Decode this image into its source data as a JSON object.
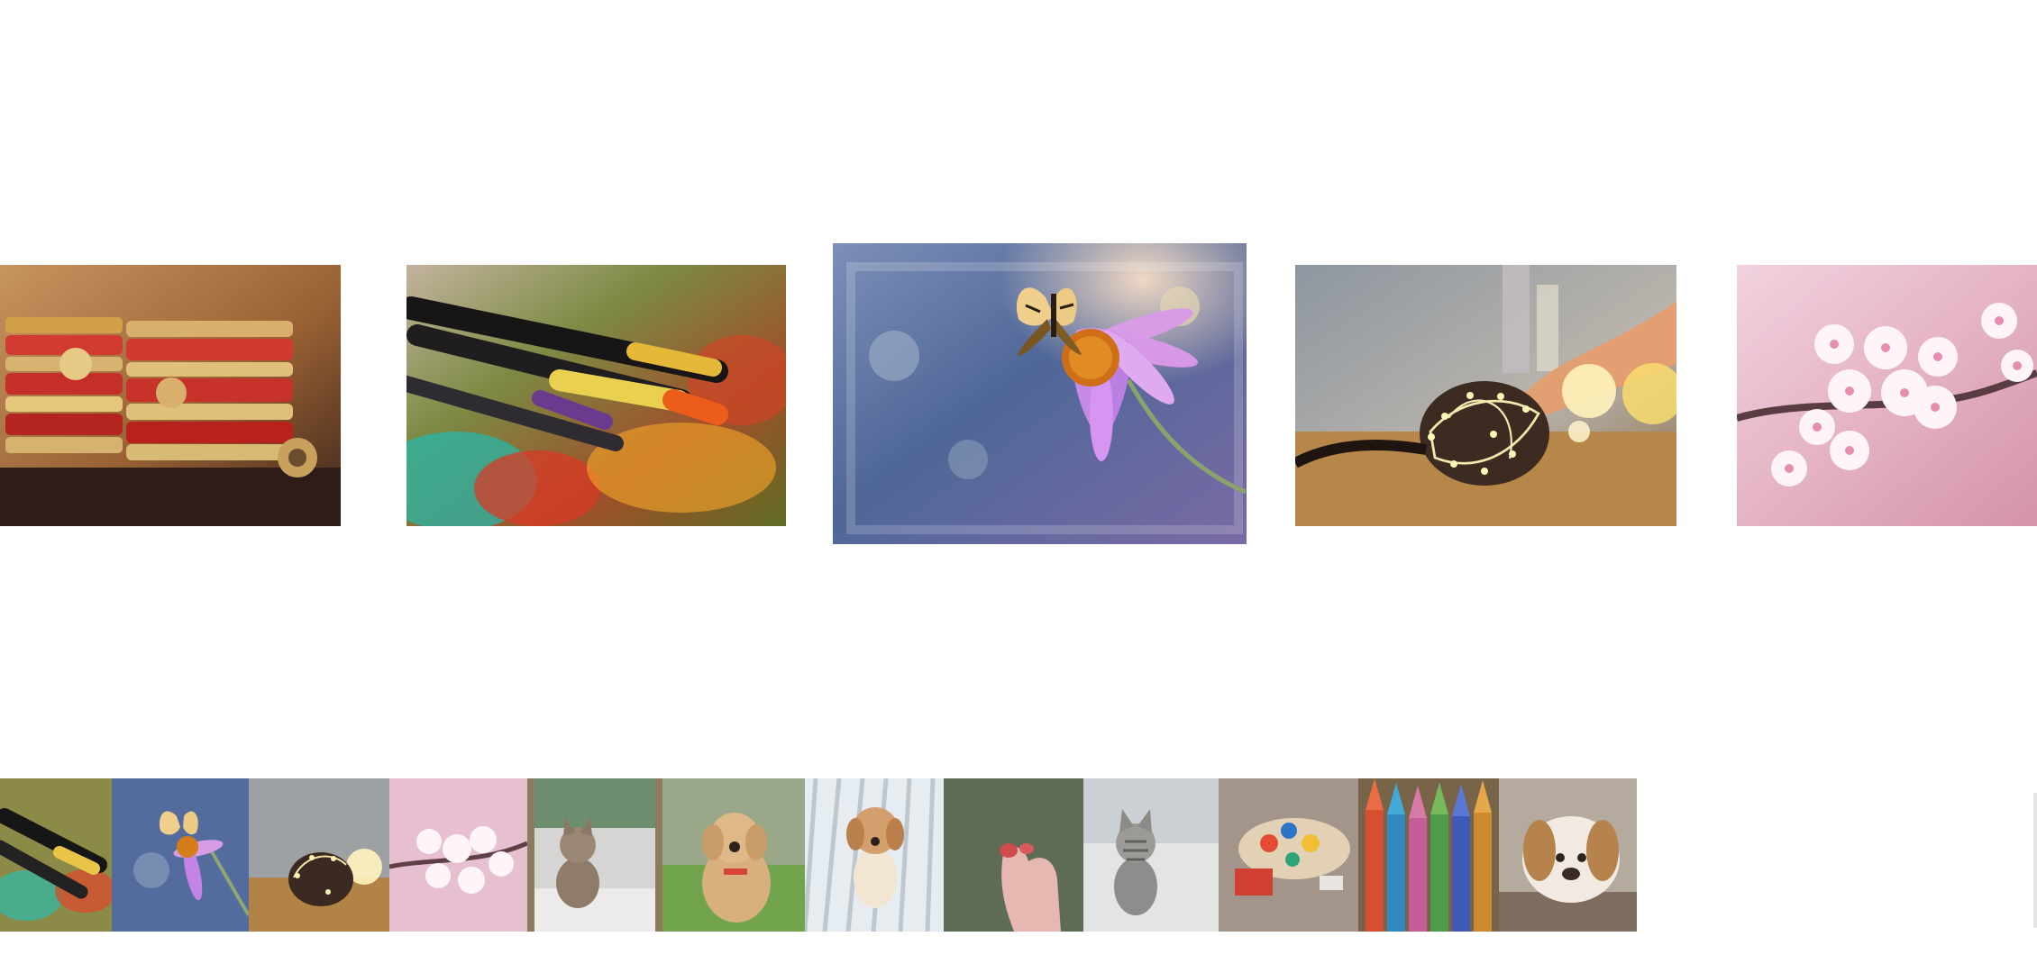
{
  "carousel": {
    "slides": [
      {
        "icon": "bangles-image",
        "caption": "",
        "colors": {
          "accent": "#c8342e",
          "bg": "#b27b4c"
        }
      },
      {
        "icon": "paintbrushes-image",
        "caption": "",
        "colors": {
          "accent": "#d55a24",
          "bg": "#8a8d42"
        }
      },
      {
        "icon": "butterfly-flower-image",
        "caption": "",
        "colors": {
          "accent": "#d597e3",
          "bg": "#5d6d9d"
        }
      },
      {
        "icon": "fairy-lights-image",
        "caption": "",
        "colors": {
          "accent": "#f6df7b",
          "bg": "#7d858c"
        }
      },
      {
        "icon": "cherry-blossom-image",
        "caption": "",
        "colors": {
          "accent": "#f5d9e8",
          "bg": "#d5a0b5"
        }
      }
    ],
    "active_index": 2
  },
  "thumbnails": [
    {
      "icon": "paintbrushes-thumb"
    },
    {
      "icon": "butterfly-thumb"
    },
    {
      "icon": "lights-thumb"
    },
    {
      "icon": "blossom-thumb"
    },
    {
      "icon": "kitten-thumb"
    },
    {
      "icon": "puppy-thumb"
    },
    {
      "icon": "puppy-deck-thumb"
    },
    {
      "icon": "hand-thumb"
    },
    {
      "icon": "tabby-kitten-thumb"
    },
    {
      "icon": "paint-palette-thumb"
    },
    {
      "icon": "colored-pencils-thumb"
    },
    {
      "icon": "sleeping-puppy-thumb"
    }
  ]
}
